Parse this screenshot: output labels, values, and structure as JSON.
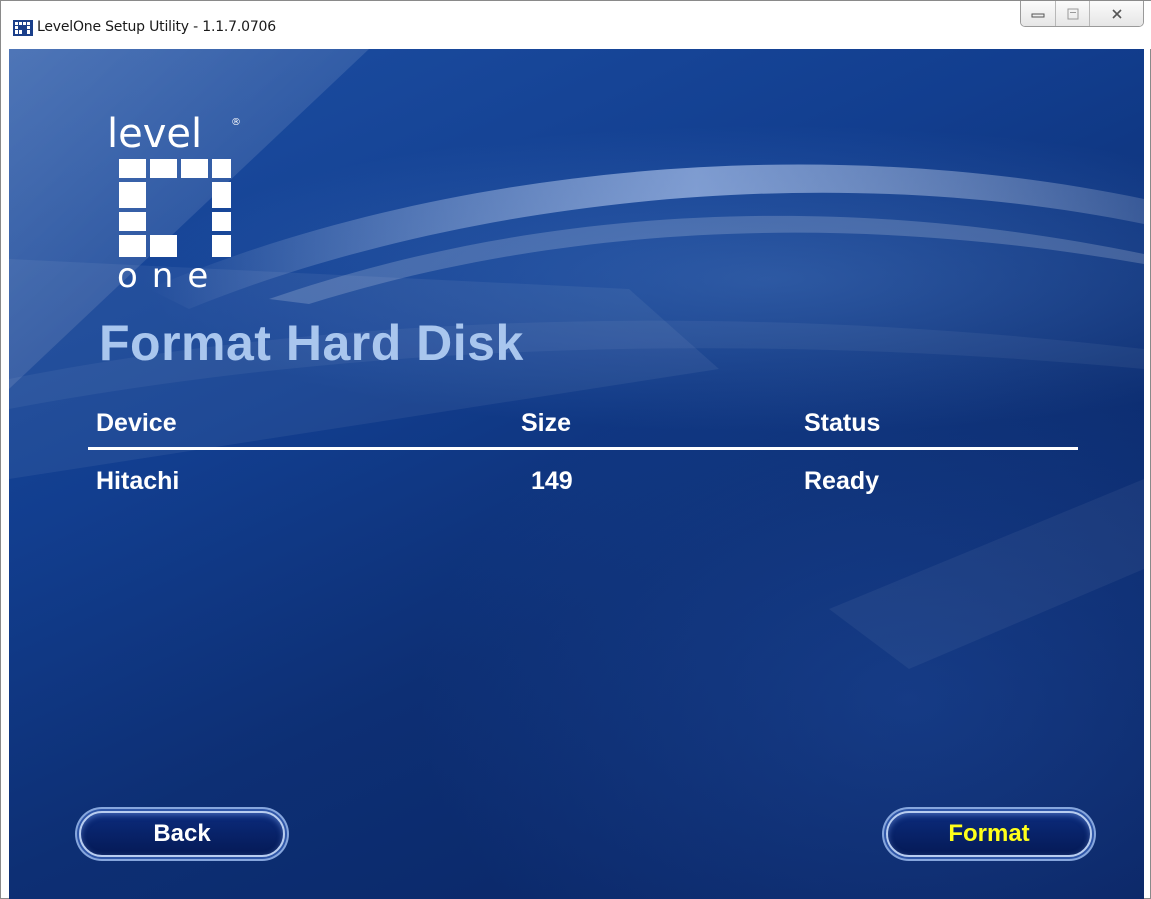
{
  "window": {
    "title": "LevelOne Setup Utility - 1.1.7.0706"
  },
  "logo": {
    "top_text": "level",
    "registered_mark": "®",
    "bottom_text": "one"
  },
  "page": {
    "title": "Format Hard Disk"
  },
  "table": {
    "headers": [
      "Device",
      "Size",
      "Status"
    ],
    "rows": [
      [
        "Hitachi",
        "149",
        "Ready"
      ]
    ]
  },
  "buttons": {
    "back": "Back",
    "format": "Format"
  },
  "colors": {
    "background": "#123e8f",
    "title": "#a9c6ee",
    "format_label": "#ffff1a"
  }
}
